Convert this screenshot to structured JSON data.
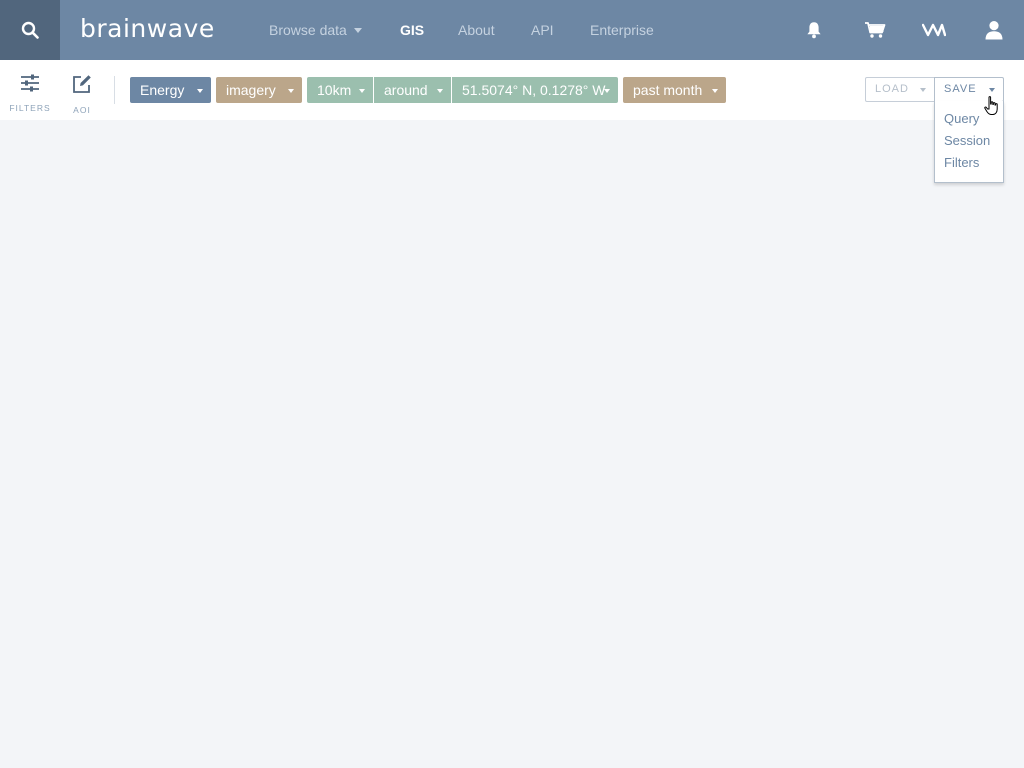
{
  "nav": {
    "logo": "brainwave",
    "links": [
      {
        "label": "Browse data",
        "has_caret": true
      },
      {
        "label": "GIS",
        "active": true
      },
      {
        "label": "About"
      },
      {
        "label": "API"
      },
      {
        "label": "Enterprise"
      }
    ],
    "icons": [
      "search-icon",
      "bell-icon",
      "cart-icon",
      "brand-mark-icon",
      "user-icon"
    ]
  },
  "toolbar": {
    "filters_label": "FILTERS",
    "aoi_label": "AOI",
    "chips": [
      {
        "label": "Energy",
        "color": "#6d87a4"
      },
      {
        "label": "imagery",
        "color": "#bba68a"
      },
      {
        "label": "10km",
        "color": "#9bbfae"
      },
      {
        "label": "around",
        "color": "#9bbfae"
      },
      {
        "label": "51.5074° N, 0.1278° W",
        "color": "#9bbfae"
      },
      {
        "label": "past month",
        "color": "#bba68a"
      }
    ],
    "load_label": "LOAD",
    "save_label": "SAVE"
  },
  "save_menu": {
    "items": [
      "Query",
      "Session",
      "Filters"
    ]
  },
  "colors": {
    "nav_bg": "#6d87a4",
    "search_bg": "#51667d",
    "page_bg": "#f3f5f8"
  }
}
